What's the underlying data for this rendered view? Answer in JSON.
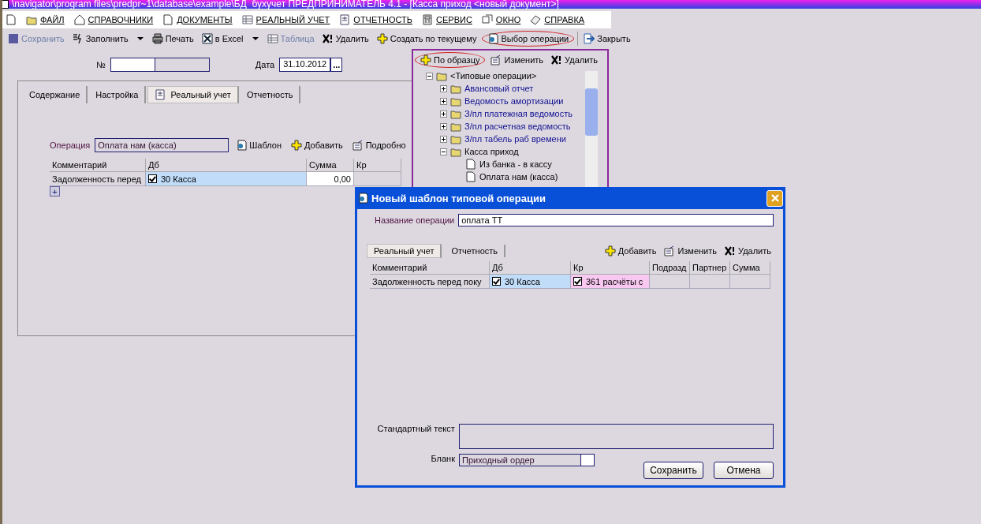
{
  "window": {
    "title": "\\navigator\\program files\\predpr~1\\database\\example\\БД_бухучет ПРЕДПРИНИМАТЕЛЬ 4.1 - [Касса приход <новый документ>]"
  },
  "menu": [
    {
      "label": "ФАЙЛ"
    },
    {
      "label": "СПРАВОЧНИКИ"
    },
    {
      "label": "ДОКУМЕНТЫ"
    },
    {
      "label": "РЕАЛЬНЫЙ УЧЕТ"
    },
    {
      "label": "ОТЧЕТНОСТЬ"
    },
    {
      "label": "СЕРВИС"
    },
    {
      "label": "ОКНО"
    },
    {
      "label": "СПРАВКА"
    }
  ],
  "toolbar": [
    {
      "label": "Сохранить",
      "disabled": true,
      "dropdown": false,
      "circled": false
    },
    {
      "label": "Заполнить",
      "disabled": false,
      "dropdown": true,
      "circled": false
    },
    {
      "label": "Печать",
      "disabled": false,
      "dropdown": false,
      "circled": false
    },
    {
      "label": "в Excel",
      "disabled": false,
      "dropdown": true,
      "circled": false
    },
    {
      "label": "Таблица",
      "disabled": true,
      "dropdown": false,
      "circled": false
    },
    {
      "label": "Удалить",
      "disabled": false,
      "dropdown": false,
      "circled": false
    },
    {
      "label": "Создать по текущему",
      "disabled": false,
      "dropdown": false,
      "circled": false
    },
    {
      "label": "Выбор операции",
      "disabled": false,
      "dropdown": false,
      "circled": true
    },
    {
      "label": "Закрыть",
      "disabled": false,
      "dropdown": false,
      "circled": false
    }
  ],
  "form": {
    "number_label": "№",
    "date_label": "Дата",
    "date_value": "31.10.2012",
    "date_button": "...",
    "tabs": [
      {
        "label": "Содержание",
        "selected": false
      },
      {
        "label": "Настройка",
        "selected": false
      },
      {
        "label": "Реальный учет",
        "selected": true
      },
      {
        "label": "Отчетность",
        "selected": false
      }
    ],
    "operation_label": "Операция",
    "operation_value": "Оплата нам (касса)",
    "actions": [
      {
        "label": "Шаблон",
        "kind": "template"
      },
      {
        "label": "Добавить",
        "kind": "add"
      },
      {
        "label": "Подробно",
        "kind": "edit"
      }
    ],
    "table": {
      "columns": [
        "Комментарий",
        "Дб",
        "Сумма",
        "Кр"
      ],
      "rows": [
        {
          "comment": "Задолженность перед",
          "db": {
            "checked": true,
            "text": "30 Касса"
          },
          "sum": "0,00"
        }
      ]
    },
    "add_row": "+"
  },
  "tree_panel": {
    "actions": [
      {
        "label": "По образцу",
        "kind": "add",
        "circled": true
      },
      {
        "label": "Изменить",
        "kind": "edit",
        "circled": false
      },
      {
        "label": "Удалить",
        "kind": "delete",
        "circled": false
      }
    ],
    "tree": [
      {
        "label": "<Типовые операции>",
        "kind": "folder",
        "expanded": true,
        "children": [
          {
            "label": "Авансовый отчет",
            "kind": "folder",
            "expanded": false
          },
          {
            "label": "Ведомость амортизации",
            "kind": "folder",
            "expanded": false
          },
          {
            "label": "З/пл платежная ведомость",
            "kind": "folder",
            "expanded": false
          },
          {
            "label": "З/пл расчетная ведомость",
            "kind": "folder",
            "expanded": false
          },
          {
            "label": "З/пл табель раб времени",
            "kind": "folder",
            "expanded": false
          },
          {
            "label": "Касса приход",
            "kind": "folder",
            "expanded": true,
            "children": [
              {
                "label": "Из банка - в кассу",
                "kind": "operation"
              },
              {
                "label": "Оплата нам (касса)",
                "kind": "operation"
              }
            ]
          }
        ]
      }
    ]
  },
  "dialog": {
    "title": "Новый шаблон типовой операции",
    "name_label": "Название операции",
    "name_value": "оплата ТТ",
    "tabs": [
      {
        "label": "Реальный учет",
        "selected": true
      },
      {
        "label": "Отчетность",
        "selected": false
      }
    ],
    "actions": [
      {
        "label": "Добавить",
        "kind": "add"
      },
      {
        "label": "Изменить",
        "kind": "edit"
      },
      {
        "label": "Удалить",
        "kind": "delete"
      }
    ],
    "table": {
      "columns": [
        "Комментарий",
        "Дб",
        "Кр",
        "Подразд",
        "Партнер",
        "Сумма"
      ],
      "rows": [
        {
          "comment": "Задолженность перед поку",
          "db": {
            "checked": true,
            "text": "30 Касса"
          },
          "kr": {
            "checked": true,
            "text": "361 расчёты с"
          }
        }
      ]
    },
    "text_label": "Стандартный текст",
    "blank_label": "Бланк",
    "blank_value": "Приходный ордер",
    "buttons": [
      "Сохранить",
      "Отмена"
    ]
  }
}
